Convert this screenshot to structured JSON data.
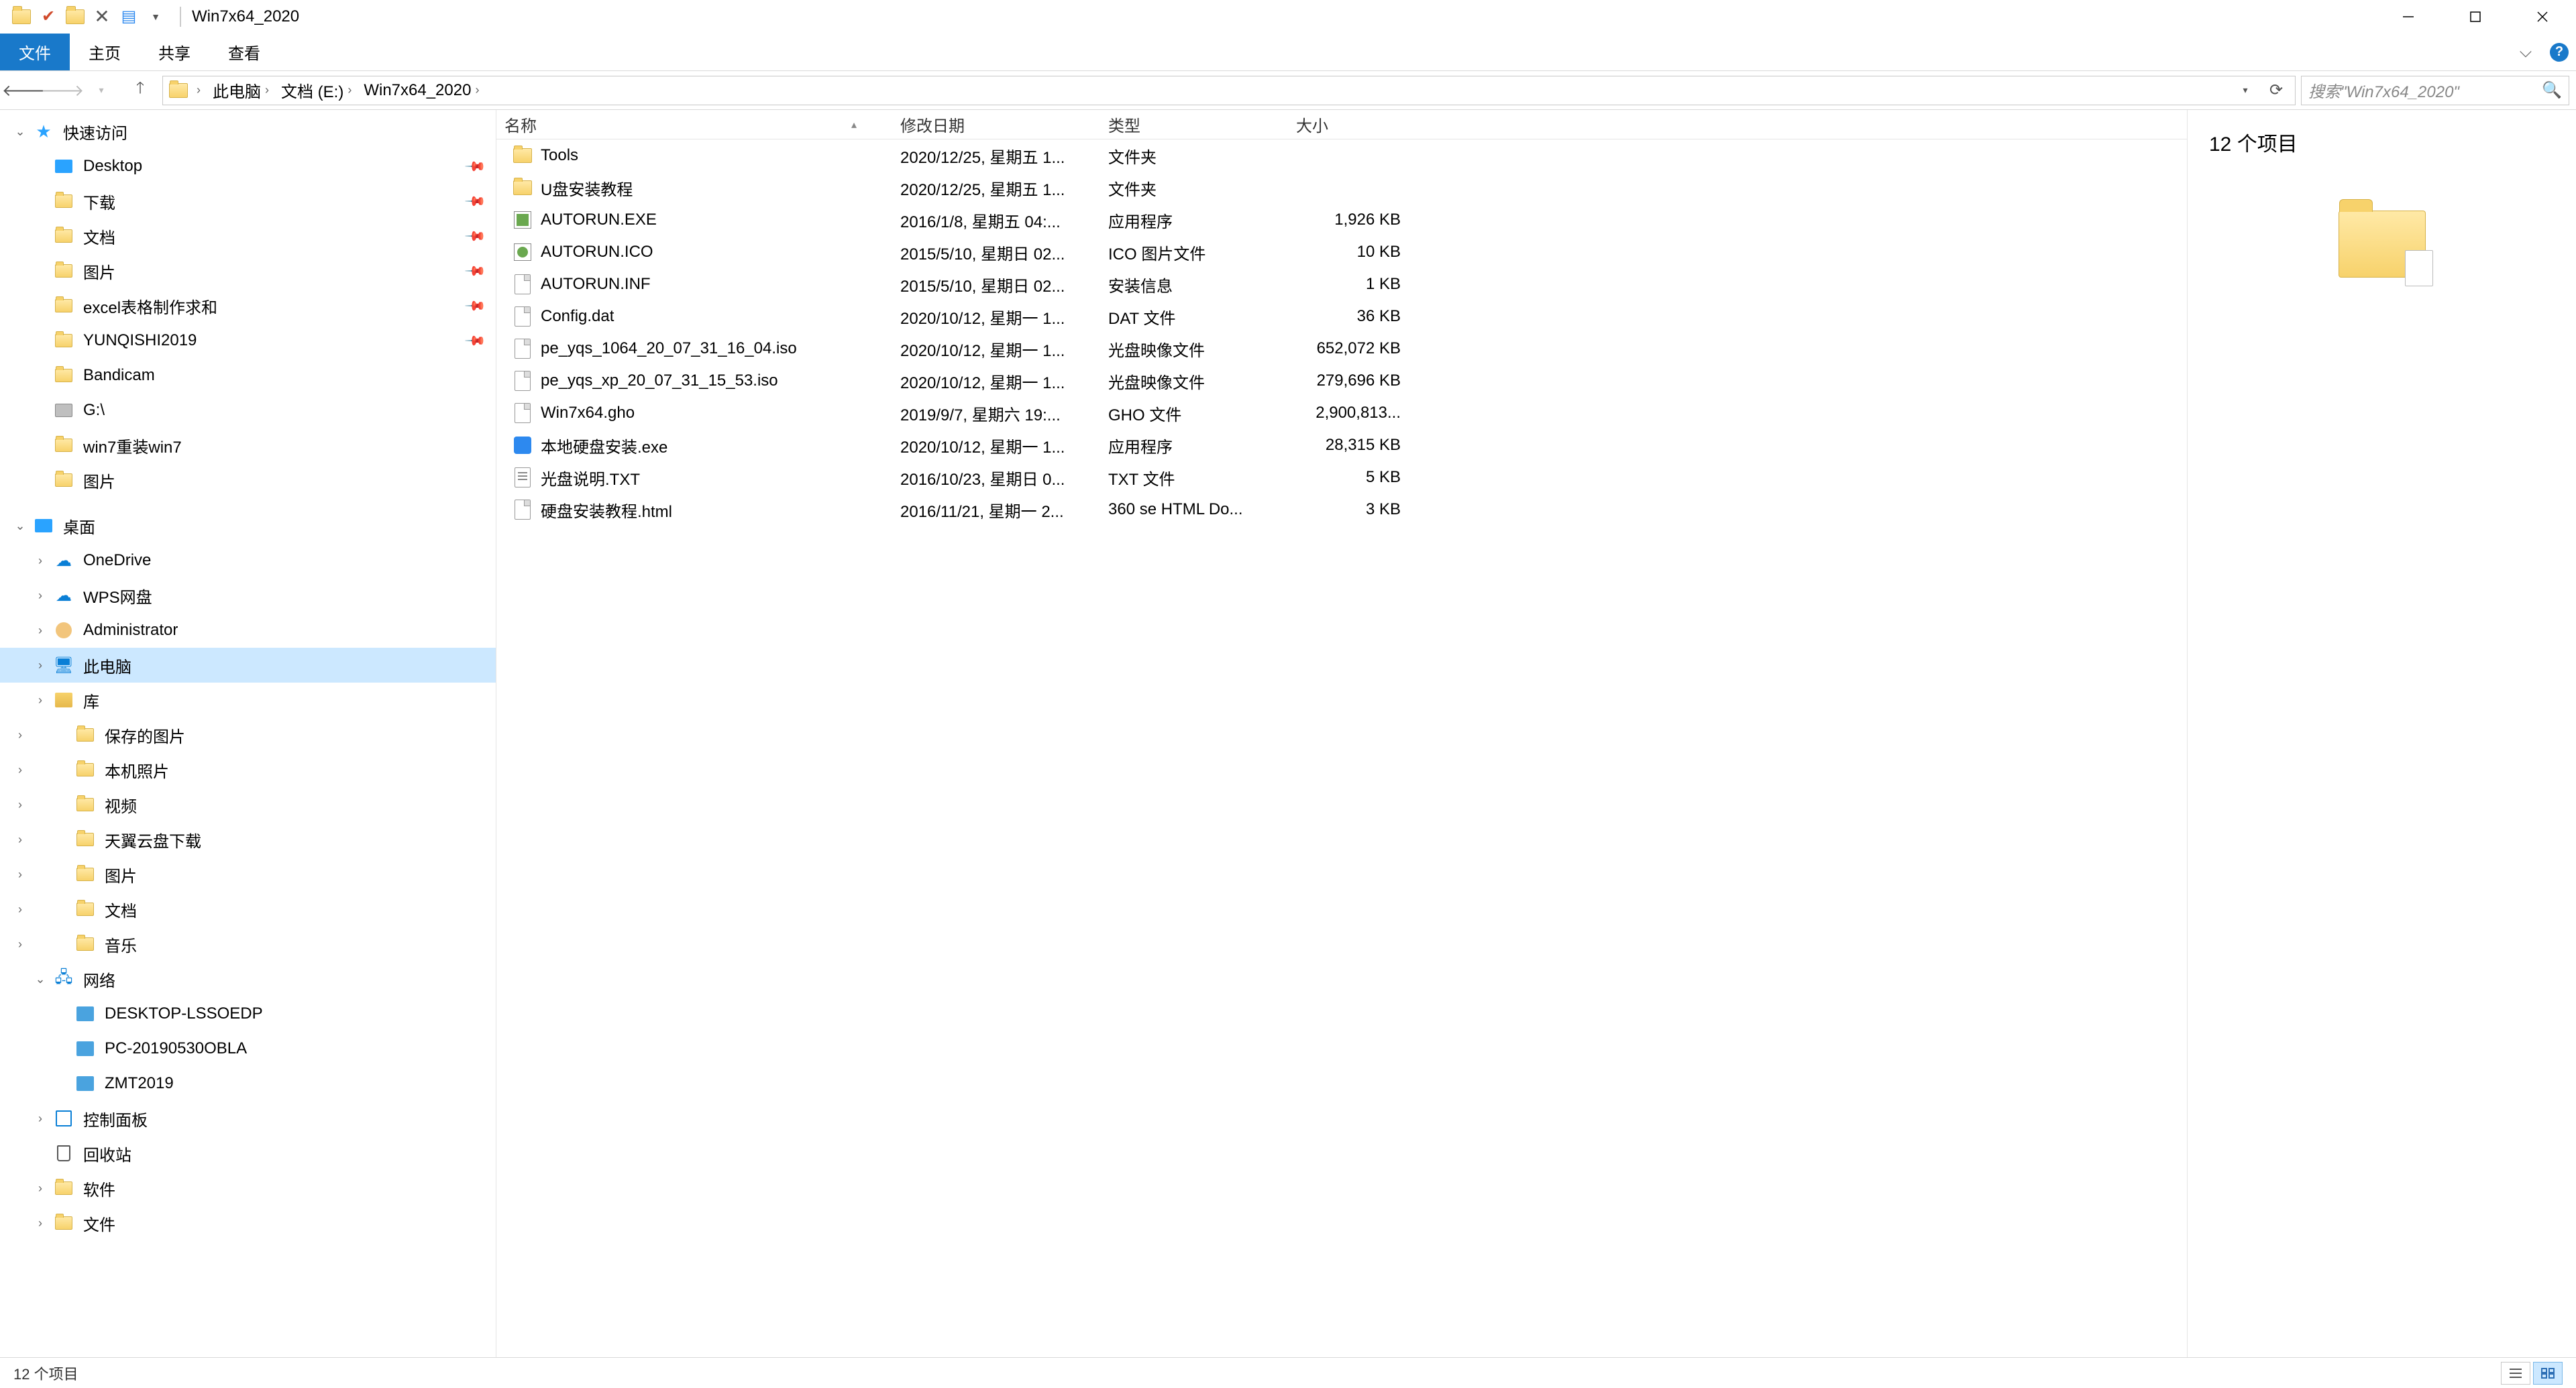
{
  "window": {
    "title": "Win7x64_2020",
    "minimize_tooltip": "最小化",
    "maximize_tooltip": "最大化",
    "close_tooltip": "关闭"
  },
  "ribbon": {
    "file": "文件",
    "home": "主页",
    "share": "共享",
    "view": "查看"
  },
  "breadcrumb": [
    {
      "label": "此电脑"
    },
    {
      "label": "文档 (E:)"
    },
    {
      "label": "Win7x64_2020"
    }
  ],
  "search": {
    "placeholder": "搜索\"Win7x64_2020\""
  },
  "tree": {
    "quick_access": "快速访问",
    "quick_items": [
      {
        "label": "Desktop",
        "pinned": true,
        "icon": "desktop"
      },
      {
        "label": "下载",
        "pinned": true,
        "icon": "folder"
      },
      {
        "label": "文档",
        "pinned": true,
        "icon": "folder"
      },
      {
        "label": "图片",
        "pinned": true,
        "icon": "folder"
      },
      {
        "label": "excel表格制作求和",
        "pinned": true,
        "icon": "folder"
      },
      {
        "label": "YUNQISHI2019",
        "pinned": true,
        "icon": "folder"
      },
      {
        "label": "Bandicam",
        "pinned": false,
        "icon": "folder"
      },
      {
        "label": "G:\\",
        "pinned": false,
        "icon": "disk"
      },
      {
        "label": "win7重装win7",
        "pinned": false,
        "icon": "folder"
      },
      {
        "label": "图片",
        "pinned": false,
        "icon": "folder"
      }
    ],
    "desktop": "桌面",
    "desktop_items": [
      {
        "label": "OneDrive",
        "icon": "cloud"
      },
      {
        "label": "WPS网盘",
        "icon": "cloud"
      },
      {
        "label": "Administrator",
        "icon": "user"
      },
      {
        "label": "此电脑",
        "icon": "pc",
        "selected": true
      },
      {
        "label": "库",
        "icon": "lib"
      }
    ],
    "lib_items": [
      {
        "label": "保存的图片",
        "icon": "folder"
      },
      {
        "label": "本机照片",
        "icon": "folder"
      },
      {
        "label": "视频",
        "icon": "folder"
      },
      {
        "label": "天翼云盘下载",
        "icon": "folder"
      },
      {
        "label": "图片",
        "icon": "folder"
      },
      {
        "label": "文档",
        "icon": "folder"
      },
      {
        "label": "音乐",
        "icon": "folder"
      }
    ],
    "network": "网络",
    "network_items": [
      {
        "label": "DESKTOP-LSSOEDP",
        "icon": "comp"
      },
      {
        "label": "PC-20190530OBLA",
        "icon": "comp"
      },
      {
        "label": "ZMT2019",
        "icon": "comp"
      }
    ],
    "control_panel": "控制面板",
    "recycle_bin": "回收站",
    "software": "软件",
    "files": "文件"
  },
  "columns": {
    "name": "名称",
    "date": "修改日期",
    "type": "类型",
    "size": "大小"
  },
  "files": [
    {
      "name": "Tools",
      "date": "2020/12/25, 星期五 1...",
      "type": "文件夹",
      "size": "",
      "icon": "folder"
    },
    {
      "name": "U盘安装教程",
      "date": "2020/12/25, 星期五 1...",
      "type": "文件夹",
      "size": "",
      "icon": "folder"
    },
    {
      "name": "AUTORUN.EXE",
      "date": "2016/1/8, 星期五 04:...",
      "type": "应用程序",
      "size": "1,926 KB",
      "icon": "exe"
    },
    {
      "name": "AUTORUN.ICO",
      "date": "2015/5/10, 星期日 02...",
      "type": "ICO 图片文件",
      "size": "10 KB",
      "icon": "ico"
    },
    {
      "name": "AUTORUN.INF",
      "date": "2015/5/10, 星期日 02...",
      "type": "安装信息",
      "size": "1 KB",
      "icon": "inf"
    },
    {
      "name": "Config.dat",
      "date": "2020/10/12, 星期一 1...",
      "type": "DAT 文件",
      "size": "36 KB",
      "icon": "dat"
    },
    {
      "name": "pe_yqs_1064_20_07_31_16_04.iso",
      "date": "2020/10/12, 星期一 1...",
      "type": "光盘映像文件",
      "size": "652,072 KB",
      "icon": "iso"
    },
    {
      "name": "pe_yqs_xp_20_07_31_15_53.iso",
      "date": "2020/10/12, 星期一 1...",
      "type": "光盘映像文件",
      "size": "279,696 KB",
      "icon": "iso"
    },
    {
      "name": "Win7x64.gho",
      "date": "2019/9/7, 星期六 19:...",
      "type": "GHO 文件",
      "size": "2,900,813...",
      "icon": "gho"
    },
    {
      "name": "本地硬盘安装.exe",
      "date": "2020/10/12, 星期一 1...",
      "type": "应用程序",
      "size": "28,315 KB",
      "icon": "blue"
    },
    {
      "name": "光盘说明.TXT",
      "date": "2016/10/23, 星期日 0...",
      "type": "TXT 文件",
      "size": "5 KB",
      "icon": "txt"
    },
    {
      "name": "硬盘安装教程.html",
      "date": "2016/11/21, 星期一 2...",
      "type": "360 se HTML Do...",
      "size": "3 KB",
      "icon": "html"
    }
  ],
  "preview": {
    "title": "12 个项目"
  },
  "statusbar": {
    "text": "12 个项目"
  }
}
